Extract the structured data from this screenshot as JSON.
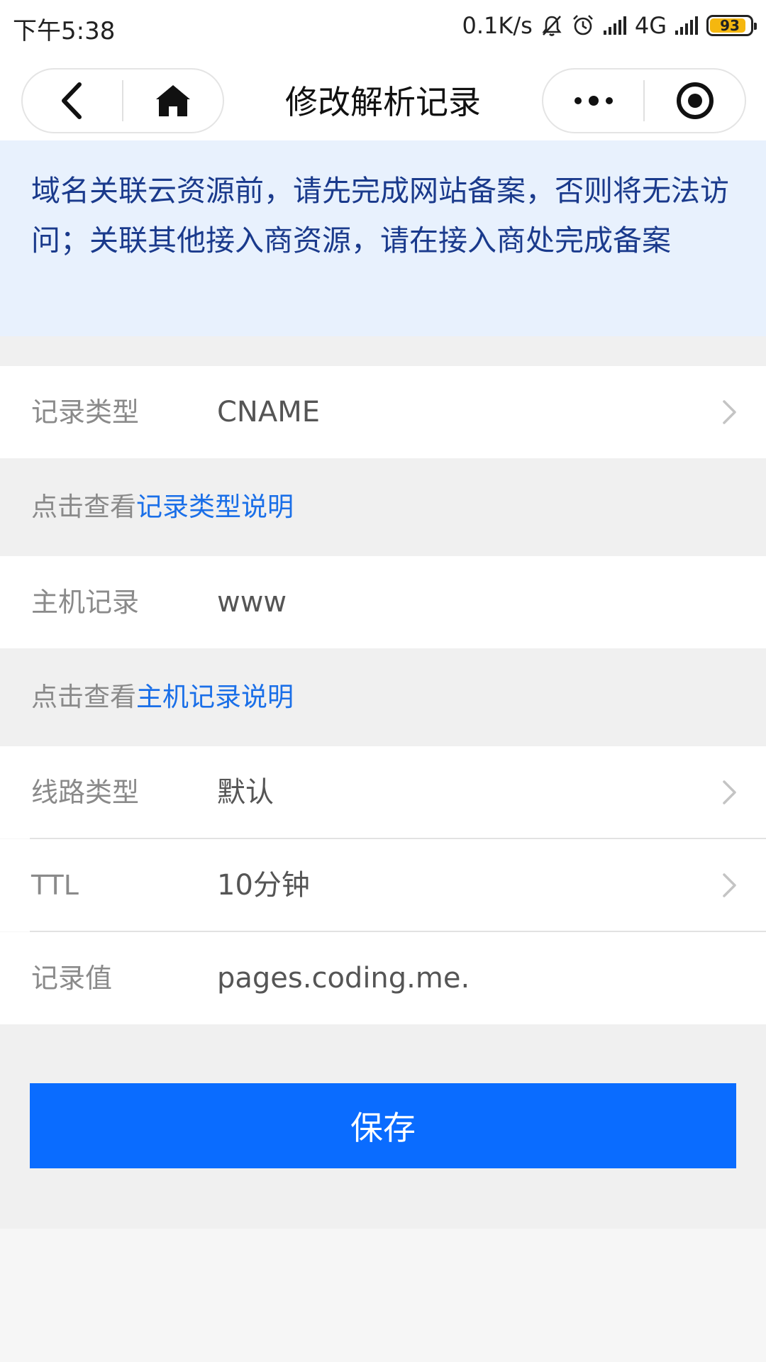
{
  "status_bar": {
    "time": "下午5:38",
    "net_speed": "0.1K/s",
    "network": "4G",
    "battery": "93",
    "battery_color": "#f5b70f"
  },
  "nav": {
    "title": "修改解析记录",
    "back_icon": "back-chevron",
    "home_icon": "home",
    "more_icon": "more-dots",
    "close_icon": "target-circle"
  },
  "notice": {
    "text": "域名关联云资源前，请先完成网站备案，否则将无法访问；关联其他接入商资源，请在接入商处完成备案",
    "bg_color": "#e8f1fd",
    "text_color": "#1a3a8c"
  },
  "form": {
    "record_type": {
      "label": "记录类型",
      "value": "CNAME"
    },
    "record_type_hint": {
      "prefix": "点击查看",
      "link": "记录类型说明"
    },
    "host": {
      "label": "主机记录",
      "value": "www"
    },
    "host_hint": {
      "prefix": "点击查看",
      "link": "主机记录说明"
    },
    "line": {
      "label": "线路类型",
      "value": "默认"
    },
    "ttl": {
      "label": "TTL",
      "value": "10分钟"
    },
    "record_value": {
      "label": "记录值",
      "value": "pages.coding.me."
    }
  },
  "actions": {
    "save_label": "保存",
    "accent_color": "#0a6cff",
    "link_color": "#1a6fe8"
  }
}
